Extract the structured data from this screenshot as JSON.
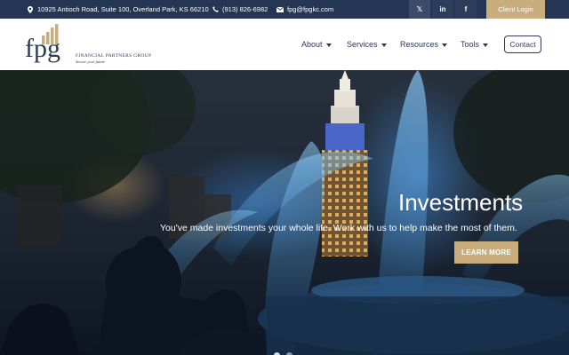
{
  "topbar": {
    "address": "10925 Antioch Road, Suite 100, Overland Park, KS 66210",
    "phone": "(913) 826-6982",
    "email": "fpg@fpgkc.com",
    "social": [
      {
        "icon": "x-icon",
        "glyph": "𝕏"
      },
      {
        "icon": "linkedin-icon",
        "glyph": "in"
      },
      {
        "icon": "facebook-icon",
        "glyph": "f"
      }
    ],
    "client_login": "Client Login"
  },
  "logo": {
    "letters": "fpg",
    "name": "FINANCIAL PARTNERS GROUP",
    "tagline": "Secure your future"
  },
  "nav": {
    "items": [
      {
        "label": "About"
      },
      {
        "label": "Services"
      },
      {
        "label": "Resources"
      },
      {
        "label": "Tools"
      }
    ],
    "contact": "Contact"
  },
  "hero": {
    "title": "Investments",
    "subtitle": "You've made investments your whole life. Work with us to help make the most of them.",
    "cta": "LEARN MORE"
  },
  "colors": {
    "topbar_bg": "#243654",
    "accent_gold": "#c9ad7d",
    "navy_text": "#2b3a55",
    "header_bg": "#ffffff"
  }
}
